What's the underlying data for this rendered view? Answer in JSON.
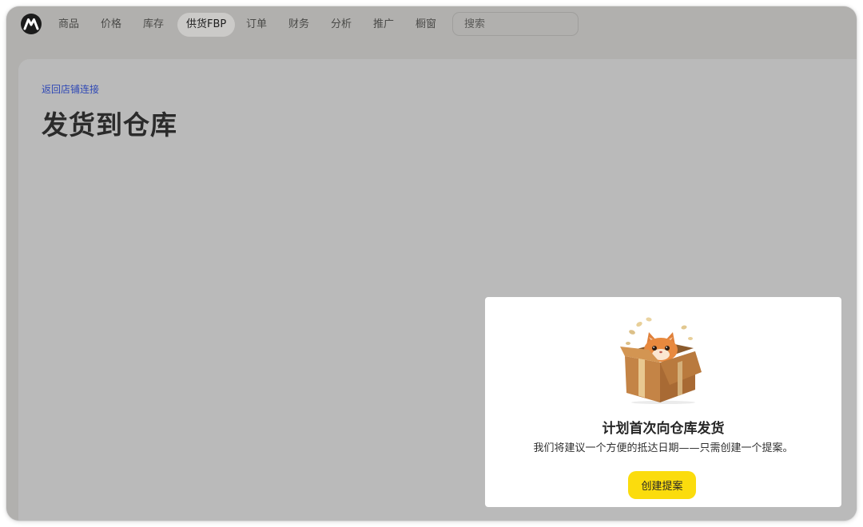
{
  "nav": {
    "items": [
      {
        "label": "商品"
      },
      {
        "label": "价格"
      },
      {
        "label": "库存"
      },
      {
        "label": "供货FBP",
        "active": true
      },
      {
        "label": "订单"
      },
      {
        "label": "财务"
      },
      {
        "label": "分析"
      },
      {
        "label": "推广"
      },
      {
        "label": "橱窗"
      }
    ],
    "search": {
      "placeholder": "搜索",
      "value": ""
    }
  },
  "main": {
    "back_link": "返回店铺连接",
    "title": "发货到仓库"
  },
  "card": {
    "title": "计划首次向仓库发货",
    "description": "我们将建议一个方便的抵达日期——只需创建一个提案。",
    "button_label": "创建提案"
  },
  "colors": {
    "accent_button": "#fbdc0d",
    "link": "#2f48b5",
    "backdrop": "#b1b0ae"
  },
  "icons": {
    "logo": "brand-logo-icon",
    "illustration": "cat-in-box-illustration"
  }
}
